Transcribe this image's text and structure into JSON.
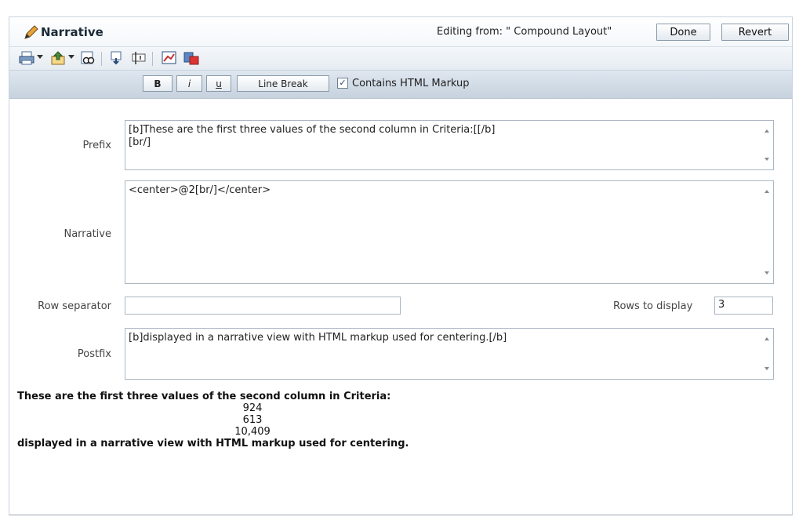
{
  "header": {
    "title": "Narrative",
    "editing_from": "Editing from: \" Compound Layout\"",
    "done_label": "Done",
    "revert_label": "Revert"
  },
  "toolbar": {
    "icons": [
      "print-icon",
      "export-icon",
      "preview-icon",
      "insert-icon",
      "properties-icon",
      "edit-view-icon",
      "format-icon"
    ]
  },
  "format": {
    "bold_label": "B",
    "italic_label": "i",
    "underline_label": "u",
    "line_break_label": "Line Break",
    "contains_html_label": "Contains HTML Markup",
    "contains_html_checked": true
  },
  "fields": {
    "prefix_label": "Prefix",
    "prefix_value": "[b]These are the first three values of the second column in Criteria:[[/b]\n[br/]",
    "narrative_label": "Narrative",
    "narrative_value": "<center>@2[br/]</center>",
    "row_separator_label": "Row separator",
    "row_separator_value": "",
    "rows_to_display_label": "Rows to display",
    "rows_to_display_value": "3",
    "postfix_label": "Postfix",
    "postfix_value": "[b]displayed in a narrative view with HTML markup used for centering.[/b]"
  },
  "preview": {
    "heading": "These are the first three values of the second column in Criteria:",
    "values": [
      "924",
      "613",
      "10,409"
    ],
    "footer": "displayed in a narrative view with HTML markup used for centering."
  }
}
